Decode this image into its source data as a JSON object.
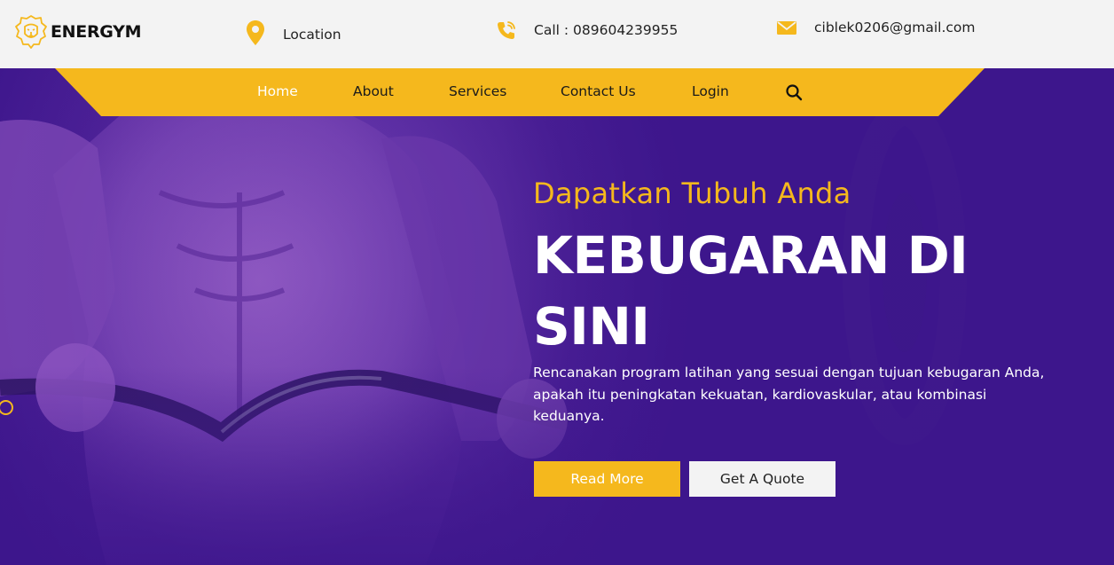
{
  "brand": {
    "name": "ENERGYM",
    "logo_icon": "lion-head-icon",
    "accent": "#f5b81d"
  },
  "topbar": {
    "location": {
      "icon": "map-pin-icon",
      "label": "Location"
    },
    "call": {
      "icon": "phone-icon",
      "label": "Call : 089604239955"
    },
    "email": {
      "icon": "envelope-icon",
      "label": "ciblek0206@gmail.com"
    }
  },
  "nav": {
    "items": [
      {
        "label": "Home",
        "active": true
      },
      {
        "label": "About"
      },
      {
        "label": "Services"
      },
      {
        "label": "Contact Us"
      },
      {
        "label": "Login"
      }
    ],
    "search_icon": "search-icon",
    "bar_color": "#f5b81d"
  },
  "hero": {
    "subheading": "Dapatkan Tubuh Anda",
    "heading": "KEBUGARAN DI SINI",
    "description": "Rencanakan program latihan yang sesuai dengan tujuan kebugaran Anda, apakah itu peningkatan kekuatan, kardiovaskular, atau kombinasi keduanya.",
    "primary_button": "Read More",
    "secondary_button": "Get A Quote",
    "overlay_color": "#3d168c"
  },
  "colors": {
    "accent": "#f5b81d",
    "hero_purple": "#3d168c",
    "topbar_bg": "#f3f3f3",
    "text_dark": "#222222"
  }
}
